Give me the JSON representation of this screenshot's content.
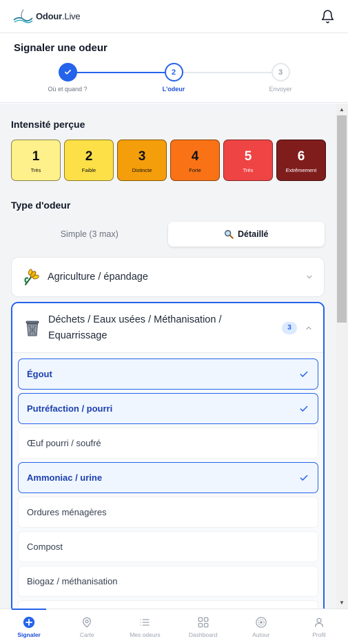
{
  "app": {
    "brand_main": "Odour",
    "brand_sub": ".Live"
  },
  "page": {
    "title": "Signaler une odeur"
  },
  "stepper": [
    {
      "number": "1",
      "label": "Où et quand ?",
      "state": "done"
    },
    {
      "number": "2",
      "label": "L'odeur",
      "state": "current"
    },
    {
      "number": "3",
      "label": "Envoyer",
      "state": "todo"
    }
  ],
  "intensity": {
    "title": "Intensité perçue",
    "levels": [
      {
        "value": "1",
        "label": "Très",
        "color": "#fef08a"
      },
      {
        "value": "2",
        "label": "Faible",
        "color": "#fde047"
      },
      {
        "value": "3",
        "label": "Distincte",
        "color": "#f59e0b"
      },
      {
        "value": "4",
        "label": "Forte",
        "color": "#f97316"
      },
      {
        "value": "5",
        "label": "Très",
        "color": "#ef4444"
      },
      {
        "value": "6",
        "label": "Extrêmement",
        "color": "#7f1d1d"
      }
    ]
  },
  "odour_type": {
    "title": "Type d'odeur",
    "mode_simple": "Simple (3 max)",
    "mode_detailed": "Détaillé",
    "active_mode": "detailed"
  },
  "categories": [
    {
      "title": "Agriculture / épandage",
      "icon": "wheat-icon",
      "expanded": false
    },
    {
      "title_line1": "Déchets / Eaux usées / Méthanisation /",
      "title_line2": "Equarrissage",
      "icon": "trash-can-icon",
      "badge": "3",
      "expanded": true,
      "options": [
        {
          "label": "Égout",
          "selected": true
        },
        {
          "label": "Putréfaction / pourri",
          "selected": true
        },
        {
          "label": "Œuf pourri / soufré",
          "selected": false
        },
        {
          "label": "Ammoniac / urine",
          "selected": true
        },
        {
          "label": "Ordures ménagères",
          "selected": false
        },
        {
          "label": "Compost",
          "selected": false
        },
        {
          "label": "Biogaz / méthanisation",
          "selected": false
        }
      ]
    }
  ],
  "bottom_nav": [
    {
      "label": "Signaler",
      "icon": "plus-circle-icon",
      "active": true
    },
    {
      "label": "Carte",
      "icon": "map-pin-icon",
      "active": false
    },
    {
      "label": "Mes odeurs",
      "icon": "list-icon",
      "active": false
    },
    {
      "label": "Dashboard",
      "icon": "grid-icon",
      "active": false
    },
    {
      "label": "Autour",
      "icon": "radar-icon",
      "active": false
    },
    {
      "label": "Profil",
      "icon": "user-icon",
      "active": false
    }
  ],
  "colors": {
    "accent": "#2563eb",
    "selected_bg": "#eff6ff"
  }
}
